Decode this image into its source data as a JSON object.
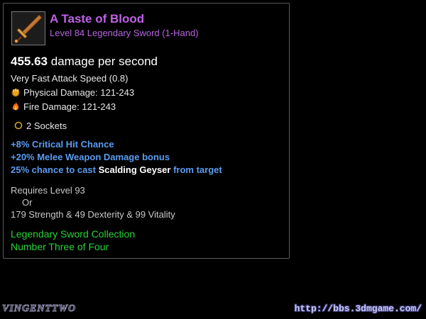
{
  "colors": {
    "name": "#c061e8",
    "type": "#b765e0",
    "stat": "#e8e8e8",
    "affix": "#5b9cf2",
    "skill": "#ffffff",
    "set": "#28d23a"
  },
  "item": {
    "icon": "sword-icon",
    "name": "A Taste of Blood",
    "type_line": "Level 84 Legendary Sword (1-Hand)",
    "dps_value": "455.63",
    "dps_label": "damage per second",
    "attack_speed": "Very Fast Attack Speed (0.8)",
    "physical_damage": "Physical Damage: 121-243",
    "fire_damage": "Fire Damage: 121-243",
    "sockets": "2 Sockets",
    "affixes": [
      "+8% Critical Hit Chance",
      "+20% Melee Weapon Damage bonus"
    ],
    "proc": {
      "prefix": "25% chance to cast",
      "skill": "Scalding Geyser",
      "suffix": "from target"
    },
    "requirements": {
      "level": "Requires Level 93",
      "or": "Or",
      "attributes": "179 Strength & 49 Dexterity & 99 Vitality"
    },
    "set": {
      "collection": "Legendary Sword Collection",
      "part": "Number Three of Four"
    }
  },
  "watermarks": {
    "left": "VINGENTTWO",
    "right": "http://bbs.3dmgame.com/"
  }
}
